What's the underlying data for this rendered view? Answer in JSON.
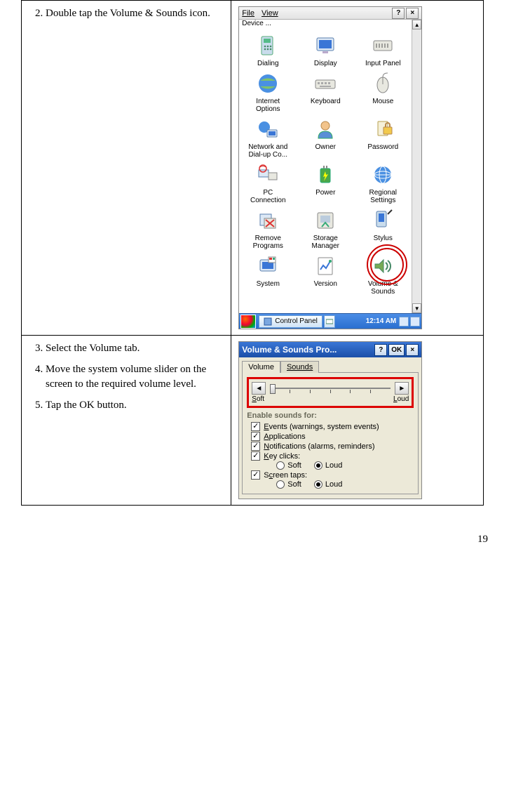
{
  "page_number": "19",
  "row1": {
    "step_num": "2.",
    "step_text": "Double tap the Volume & Sounds icon.",
    "menubar": {
      "file": "File",
      "view": "View",
      "help": "?",
      "close": "×"
    },
    "header_left": "Device ...",
    "cp_items": [
      {
        "label": "Dialing"
      },
      {
        "label": "Display"
      },
      {
        "label": "Input Panel"
      },
      {
        "label": "Internet\nOptions"
      },
      {
        "label": "Keyboard"
      },
      {
        "label": "Mouse"
      },
      {
        "label": "Network and\nDial-up Co..."
      },
      {
        "label": "Owner"
      },
      {
        "label": "Password"
      },
      {
        "label": "PC\nConnection"
      },
      {
        "label": "Power"
      },
      {
        "label": "Regional\nSettings"
      },
      {
        "label": "Remove\nPrograms"
      },
      {
        "label": "Storage\nManager"
      },
      {
        "label": "Stylus"
      },
      {
        "label": "System"
      },
      {
        "label": "Version"
      },
      {
        "label": "Volume &\nSounds"
      }
    ],
    "taskbar": {
      "app": "Control Panel",
      "time": "12:14 AM"
    }
  },
  "row2": {
    "steps": [
      {
        "num": "3.",
        "text": "Select the Volume tab."
      },
      {
        "num": "4.",
        "text": "Move the system volume slider on the screen to the required volume level."
      },
      {
        "num": "5.",
        "text": "Tap the OK button."
      }
    ],
    "title": "Volume & Sounds Pro...",
    "title_help": "?",
    "title_ok": "OK",
    "title_close": "×",
    "tabs": {
      "volume": "Volume",
      "sounds": "Sounds"
    },
    "slider": {
      "left": "◄",
      "right": "►",
      "soft": "Soft",
      "loud": "Loud"
    },
    "enable_header": "Enable sounds for:",
    "checks": {
      "events": "Events (warnings, system events)",
      "apps": "Applications",
      "notif": "Notifications (alarms, reminders)",
      "key": "Key clicks:",
      "screen": "Screen taps:"
    },
    "radio": {
      "soft": "Soft",
      "loud": "Loud"
    }
  }
}
